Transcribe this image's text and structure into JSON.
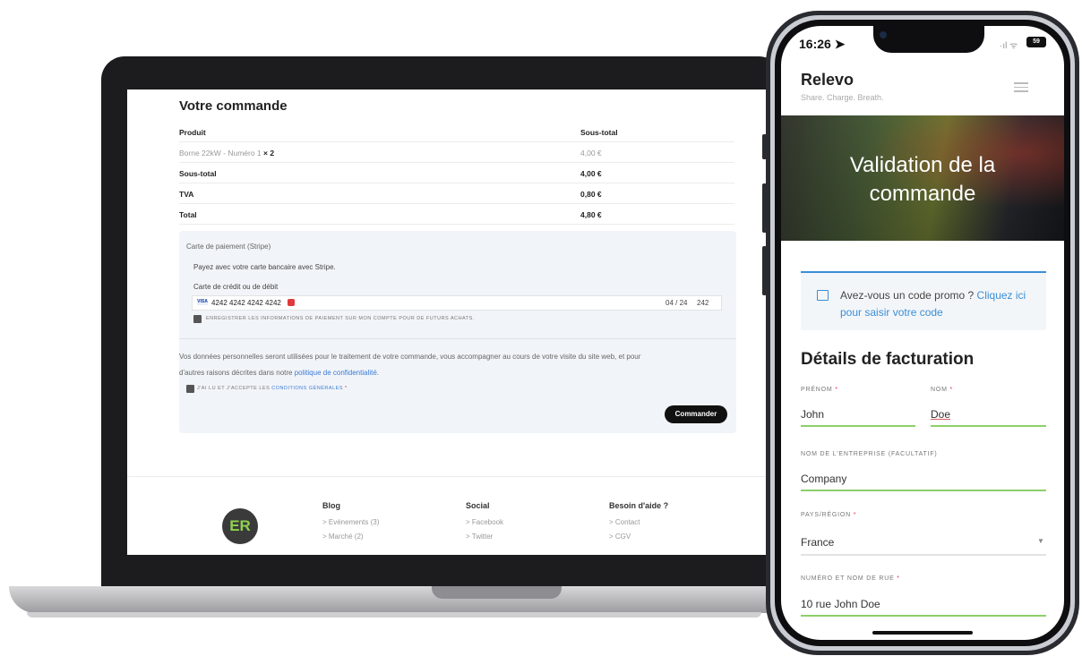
{
  "laptop": {
    "order_title": "Votre commande",
    "table": {
      "headers": [
        "Produit",
        "Sous-total"
      ],
      "rows": [
        {
          "label": "Borne 22kW - Numéro 1",
          "qty": "× 2",
          "value": "4,00 €"
        },
        {
          "label": "Sous-total",
          "value": "4,00 €"
        },
        {
          "label": "TVA",
          "value": "0,80 €"
        },
        {
          "label": "Total",
          "value": "4,80 €"
        }
      ]
    },
    "payment": {
      "method_label": "Carte de paiement (Stripe)",
      "description": "Payez avec votre carte bancaire avec Stripe.",
      "card_label": "Carte de crédit ou de débit",
      "card_brand": "VISA",
      "card_number": "4242 4242 4242 4242",
      "expiry": "04 / 24",
      "cvc": "242",
      "save_label": "Enregistrer les informations de paiement sur mon compte pour de futurs achats."
    },
    "privacy": {
      "text_1": "Vos données personnelles seront utilisées pour le traitement de votre commande, vous accompagner au cours de votre visite du site web, et pour",
      "text_2": "d'autres raisons décrites dans notre ",
      "link": "politique de confidentialité",
      "text_3": ".",
      "terms_prefix": "J'ai lu et j'accepte les ",
      "terms_link": "conditions générales",
      "terms_star": "*"
    },
    "order_button": "Commander",
    "footer": {
      "logo": "ER",
      "columns": [
        {
          "title": "Blog",
          "items": [
            "> Evénements (3)",
            "> Marché (2)"
          ]
        },
        {
          "title": "Social",
          "items": [
            "> Facebook",
            "> Twitter"
          ]
        },
        {
          "title": "Besoin d'aide ?",
          "items": [
            "> Contact",
            "> CGV"
          ]
        }
      ]
    }
  },
  "phone": {
    "status": {
      "time": "16:26",
      "signal": "·ıl ᯤ",
      "battery": "59"
    },
    "brand": "Relevo",
    "tagline": "Share. Charge. Breath.",
    "hero_line1": "Validation de la",
    "hero_line2": "commande",
    "promo_text": "Avez-vous un code promo ? ",
    "promo_link": "Cliquez ici pour saisir votre code",
    "billing_title": "Détails de facturation",
    "fields": {
      "first_name": {
        "label": "Prénom",
        "value": "John"
      },
      "last_name": {
        "label": "Nom",
        "value": "Doe"
      },
      "company": {
        "label": "Nom de l'entreprise (facultatif)",
        "value": "Company"
      },
      "country": {
        "label": "Pays/région",
        "value": "France"
      },
      "street": {
        "label": "Numéro et nom de rue",
        "value": "10 rue John Doe"
      }
    },
    "required_star": "*"
  },
  "colors": {
    "accent_blue": "#3b8fd6",
    "field_green": "#8ccf6a",
    "required_red": "#e0344a",
    "button_black": "#111111"
  }
}
